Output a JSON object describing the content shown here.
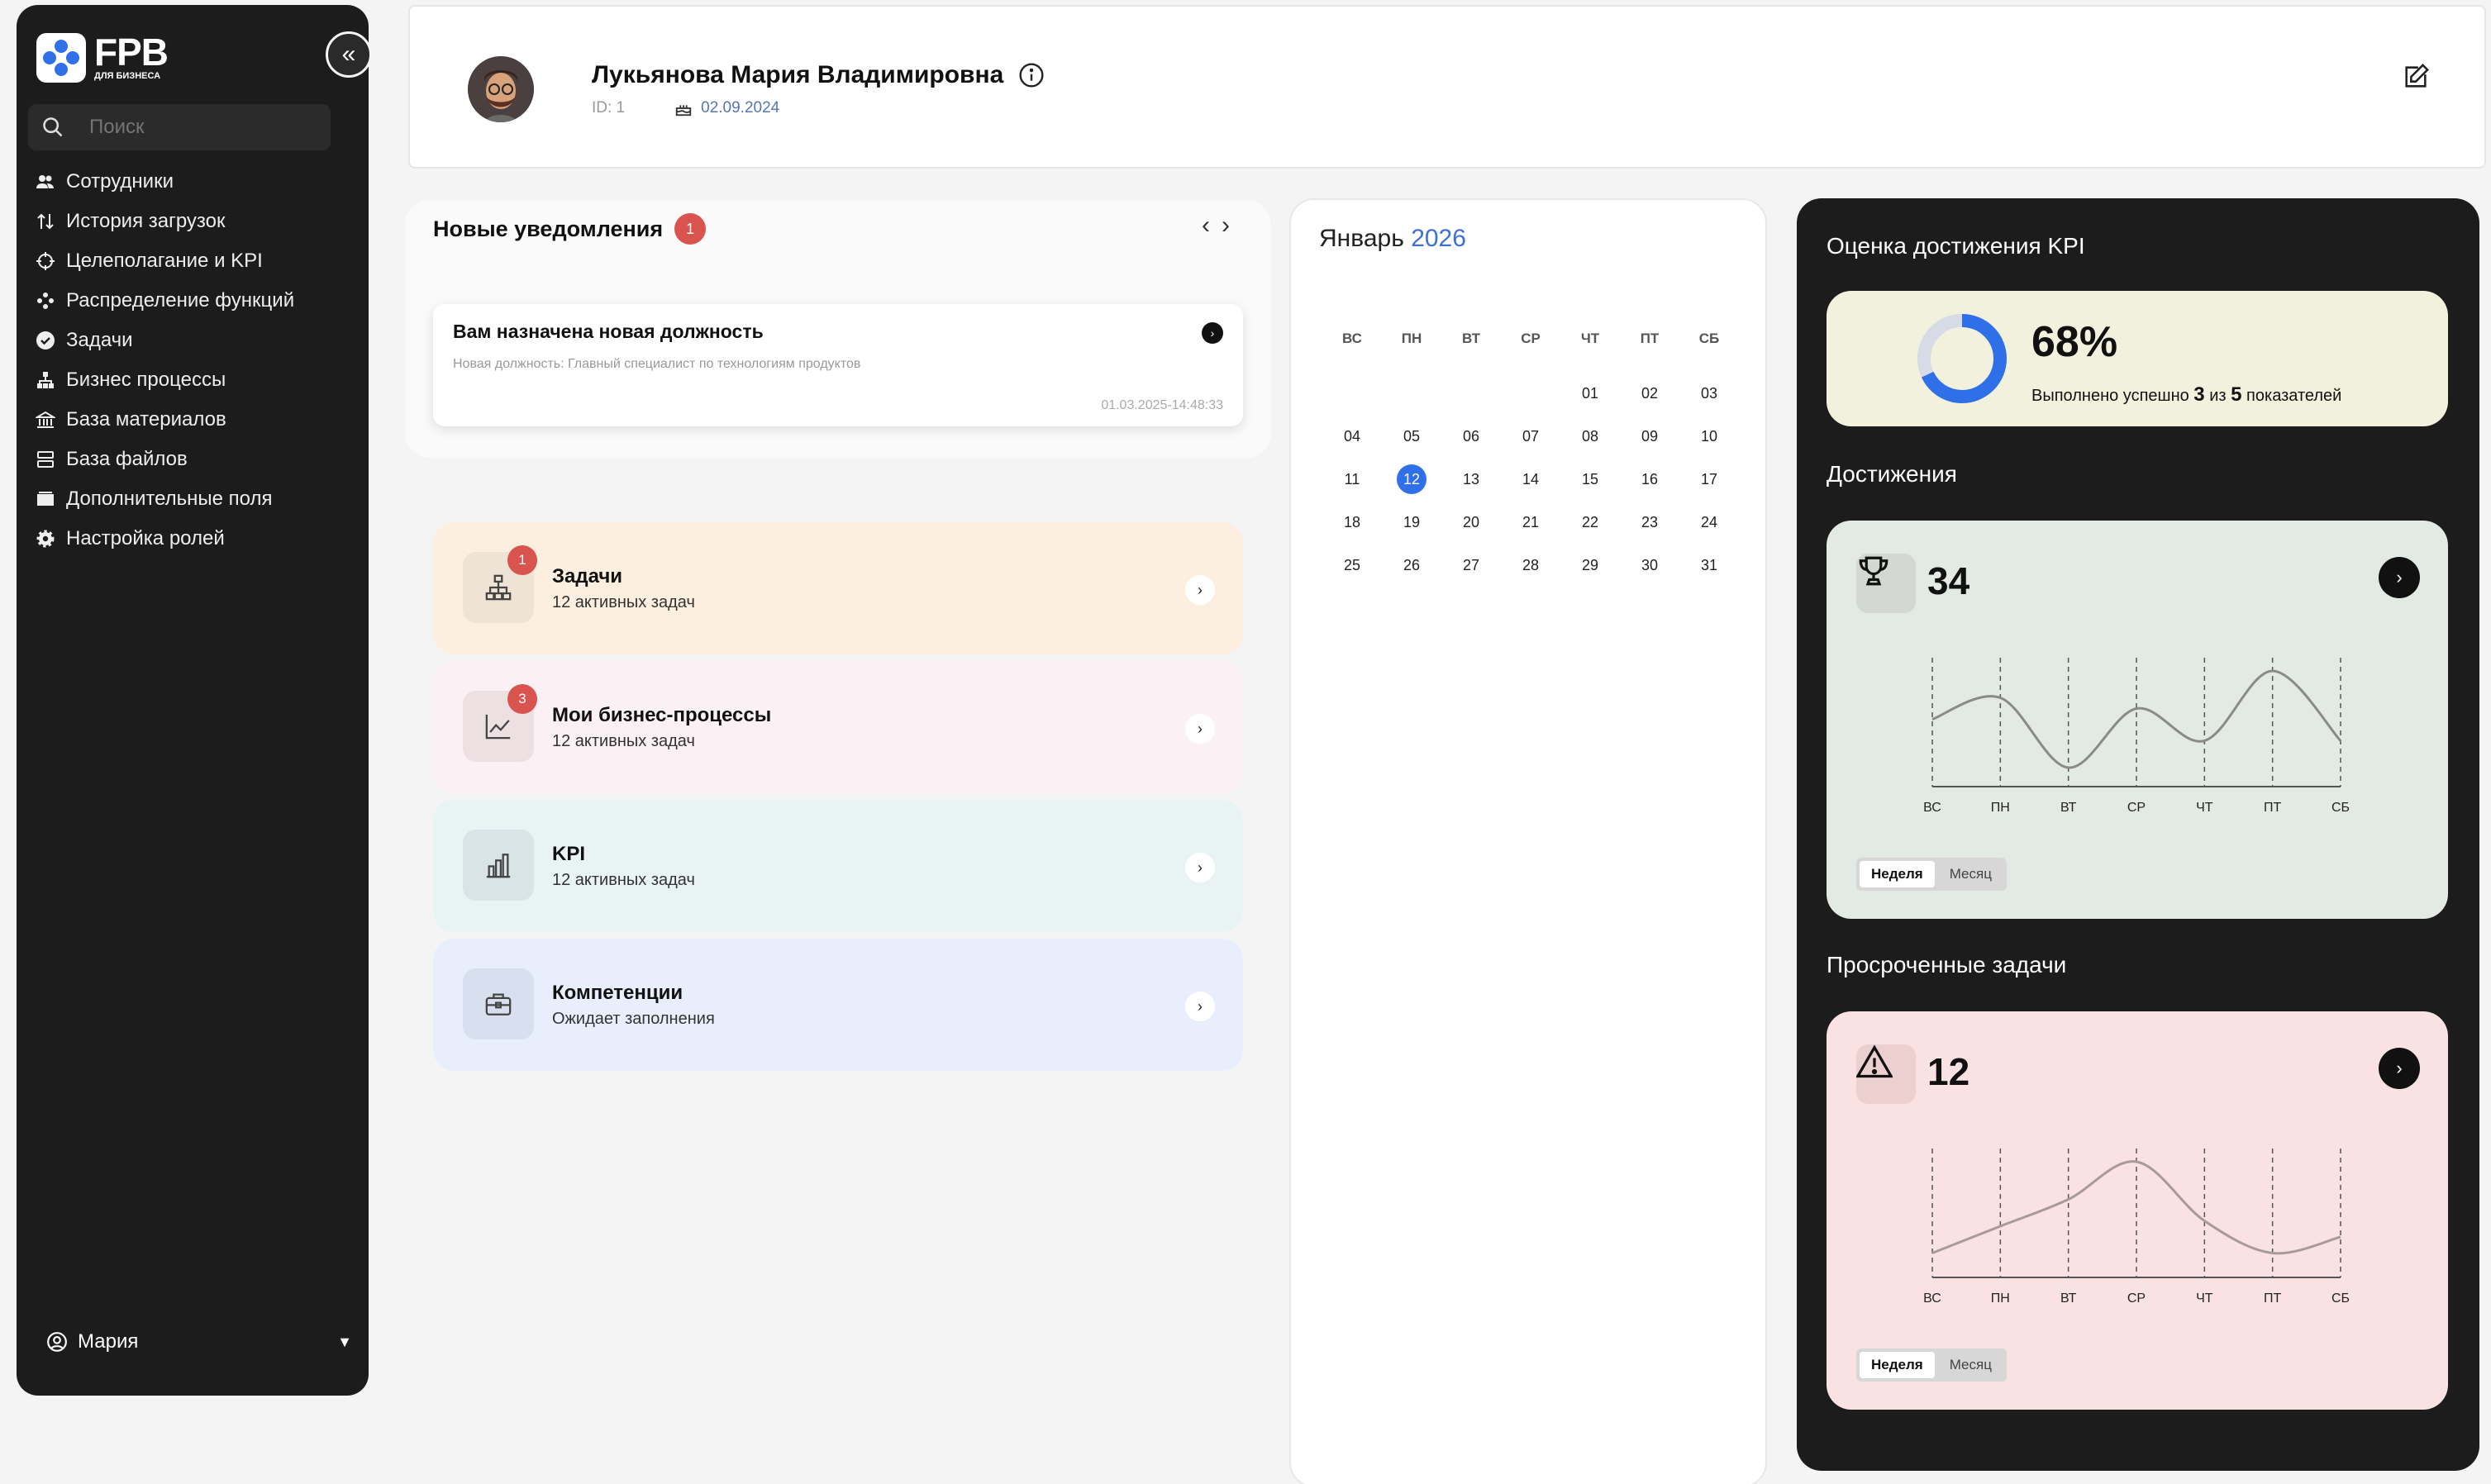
{
  "sidebar": {
    "logo_text": "FPB",
    "logo_sub": "ДЛЯ БИЗНЕСА",
    "search_placeholder": "Поиск",
    "items": [
      {
        "label": "Сотрудники",
        "icon": "users-icon"
      },
      {
        "label": "История загрузок",
        "icon": "upload-history-icon"
      },
      {
        "label": "Целеполагание и KPI",
        "icon": "target-icon"
      },
      {
        "label": "Распределение функций",
        "icon": "functions-icon"
      },
      {
        "label": "Задачи",
        "icon": "check-circle-icon"
      },
      {
        "label": "Бизнес процессы",
        "icon": "hierarchy-icon"
      },
      {
        "label": "База материалов",
        "icon": "library-icon"
      },
      {
        "label": "База файлов",
        "icon": "server-icon"
      },
      {
        "label": "Дополнительные поля",
        "icon": "folder-icon"
      },
      {
        "label": "Настройка ролей",
        "icon": "gear-icon"
      }
    ],
    "user_name": "Мария"
  },
  "profile": {
    "name": "Лукьянова Мария Владимировна",
    "id_text": "ID: 1",
    "birth_date": "02.09.2024"
  },
  "notifications": {
    "title": "Новые уведомления",
    "count": "1",
    "items": [
      {
        "title": "Вам назначена новая должность",
        "description": "Новая должность: Главный специалист по технологиям продуктов",
        "timestamp": "01.03.2025-14:48:33"
      }
    ]
  },
  "quick_cards": [
    {
      "title": "Задачи",
      "subtitle": "12 активных задач",
      "badge": "1",
      "bg": "#fcefdf",
      "icon_bg": "#eee3d4"
    },
    {
      "title": "Мои бизнес-процессы",
      "subtitle": "12 активных задач",
      "badge": "3",
      "bg": "#fbf0f3",
      "icon_bg": "#ede0e3"
    },
    {
      "title": "KPI",
      "subtitle": "12 активных задач",
      "badge": "",
      "bg": "#e8f3f4",
      "icon_bg": "#d9e4e6"
    },
    {
      "title": "Компетенции",
      "subtitle": "Ожидает заполнения",
      "badge": "",
      "bg": "#e8eefc",
      "icon_bg": "#d8dfee"
    }
  ],
  "calendar": {
    "month": "Январь",
    "year": "2026",
    "weekdays": [
      "ВС",
      "ПН",
      "ВТ",
      "СР",
      "ЧТ",
      "ПТ",
      "СБ"
    ],
    "leading_blanks": 4,
    "days": [
      "01",
      "02",
      "03",
      "04",
      "05",
      "06",
      "07",
      "08",
      "09",
      "10",
      "11",
      "12",
      "13",
      "14",
      "15",
      "16",
      "17",
      "18",
      "19",
      "20",
      "21",
      "22",
      "23",
      "24",
      "25",
      "26",
      "27",
      "28",
      "29",
      "30",
      "31"
    ],
    "today": "12"
  },
  "kpi": {
    "title": "Оценка достижения KPI",
    "percent": "68%",
    "percent_value": 68,
    "desc_prefix": "Выполнено успешно",
    "done": "3",
    "desc_mid": "из",
    "total": "5",
    "desc_suffix": "показателей"
  },
  "achievements": {
    "title": "Достижения",
    "value": "34",
    "bg": "#e3eae3",
    "chart_data": {
      "type": "line",
      "categories": [
        "ВС",
        "ПН",
        "ВТ",
        "СР",
        "ЧТ",
        "ПТ",
        "СБ"
      ],
      "values": [
        0.55,
        0.75,
        0.1,
        0.65,
        0.35,
        1.0,
        0.35
      ]
    },
    "toggle": [
      "Неделя",
      "Месяц"
    ]
  },
  "overdue": {
    "title": "Просроченные задачи",
    "value": "12",
    "bg": "#fbe2e2",
    "chart_data": {
      "type": "line",
      "categories": [
        "ВС",
        "ПН",
        "ВТ",
        "СР",
        "ЧТ",
        "ПТ",
        "СБ"
      ],
      "values": [
        0.15,
        0.4,
        0.65,
        1.0,
        0.45,
        0.15,
        0.3
      ]
    },
    "toggle": [
      "Неделя",
      "Месяц"
    ]
  }
}
